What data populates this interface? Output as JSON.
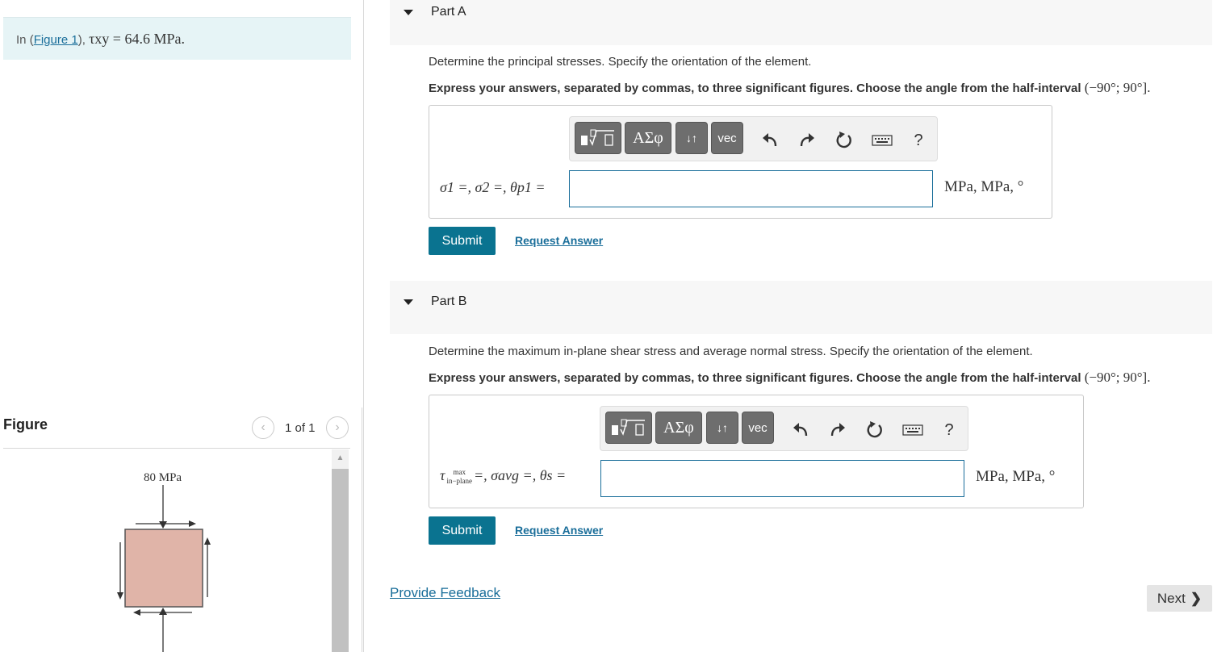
{
  "problem": {
    "prefix": "In (",
    "figure_link": "Figure 1",
    "suffix": "), ",
    "math": "τxy = 64.6 MPa."
  },
  "figure": {
    "title": "Figure",
    "page": "1 of 1",
    "label_top": "80 MPa",
    "colors": {
      "element_fill": "#e0b4a8",
      "element_stroke": "#555555"
    }
  },
  "partA": {
    "title": "Part A",
    "question": "Determine the principal stresses. Specify the orientation of the element.",
    "instructions": "Express your answers, separated by commas, to three significant figures. Choose the angle from the half-interval",
    "interval": "(−90°; 90°].",
    "answer_label": "σ1 =, σ2 =, θp1 =",
    "answer_value": "",
    "units": "MPa,  MPa,  °",
    "submit": "Submit",
    "request": "Request Answer"
  },
  "partB": {
    "title": "Part B",
    "question": "Determine the maximum in-plane shear stress and average normal stress. Specify the orientation of the element.",
    "instructions": "Express your answers, separated by commas, to three significant figures. Choose the angle from the half-interval",
    "interval": "(−90°; 90°].",
    "answer_label_tau": "τ",
    "answer_label_sub_top": "max",
    "answer_label_sub_bottom": "in−plane",
    "answer_label_rest": "=, σavg =, θs =",
    "answer_value": "",
    "units": "MPa,  MPa,  °",
    "submit": "Submit",
    "request": "Request Answer"
  },
  "toolbar": {
    "templates_icon": "templates-icon",
    "greek": "ΑΣφ",
    "updown": "↓↑",
    "vec": "vec",
    "help": "?"
  },
  "footer": {
    "feedback": "Provide Feedback",
    "next": "Next"
  },
  "colors": {
    "accent": "#0a7390",
    "link": "#1a6e9a",
    "problem_bg": "#e6f4f6"
  }
}
